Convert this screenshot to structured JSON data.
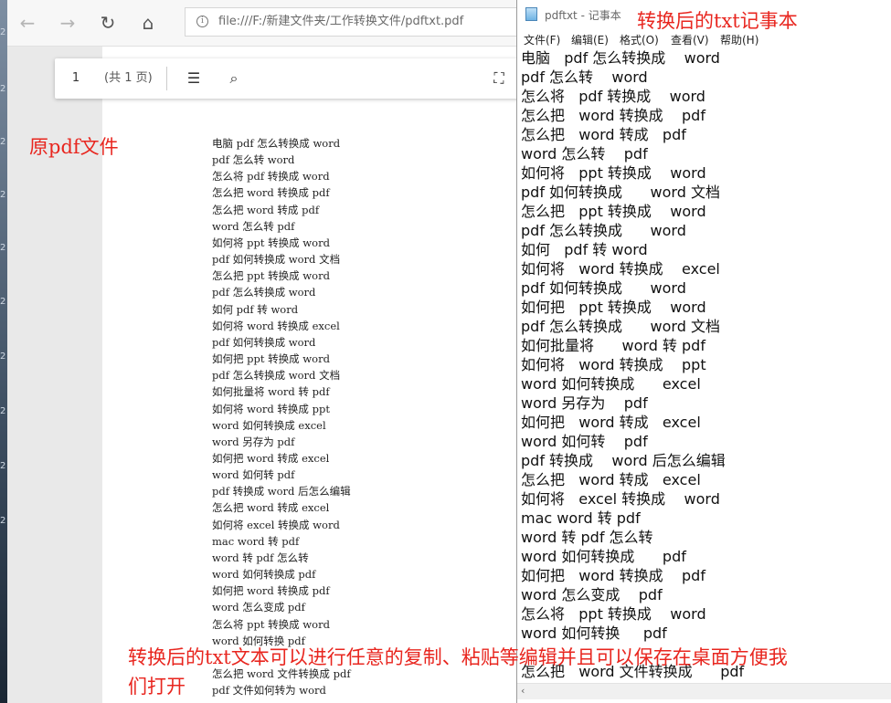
{
  "browser": {
    "back_icon": "←",
    "forward_icon": "→",
    "refresh_icon": "↻",
    "home_icon": "⌂",
    "info_icon": "i",
    "url": "file:///F:/新建文件夹/工作转换文件/pdftxt.pdf"
  },
  "pdf_toolbar": {
    "page_number": "1",
    "page_count": "(共 1 页)",
    "toc_icon": "☰",
    "search_icon": "⌕",
    "fit_icon": "⛶"
  },
  "pdf_lines": [
    "电脑 pdf 怎么转换成 word",
    "pdf 怎么转 word",
    "怎么将 pdf 转换成 word",
    "怎么把 word 转换成 pdf",
    "怎么把 word 转成 pdf",
    "word 怎么转 pdf",
    "如何将 ppt 转换成 word",
    "pdf 如何转换成 word 文档",
    "怎么把 ppt 转换成 word",
    "pdf 怎么转换成 word",
    "如何 pdf 转 word",
    "如何将 word 转换成 excel",
    "pdf 如何转换成 word",
    "如何把 ppt 转换成 word",
    "pdf 怎么转换成 word 文档",
    "如何批量将 word 转 pdf",
    "如何将 word 转换成 ppt",
    "word 如何转换成 excel",
    "word 另存为 pdf",
    "如何把 word 转成 excel",
    "word 如何转 pdf",
    "pdf 转换成 word 后怎么编辑",
    "怎么把 word 转成 excel",
    "如何将 excel 转换成 word",
    "mac word 转 pdf",
    "word 转 pdf 怎么转",
    "word 如何转换成 pdf",
    "如何把 word 转换成 pdf",
    "word 怎么变成 pdf",
    "怎么将 ppt 转换成 word",
    "word 如何转换 pdf",
    "",
    "怎么把 word 文件转换成 pdf",
    "pdf 文件如何转为 word"
  ],
  "annotations": {
    "pdf_label": "原pdf文件",
    "txt_label": "转换后的txt记事本",
    "bottom_line1": "转换后的txt文本可以进行任意的复制、粘贴等编辑并且可以保存在桌面方便我",
    "bottom_line2": "们打开"
  },
  "notepad": {
    "title": "pdftxt - 记事本",
    "menu": [
      "文件(F)",
      "编辑(E)",
      "格式(O)",
      "查看(V)",
      "帮助(H)"
    ],
    "scroll_left_icon": "‹",
    "lines": [
      "电脑   pdf 怎么转换成    word",
      "pdf 怎么转    word",
      "怎么将   pdf 转换成    word",
      "怎么把   word 转换成    pdf",
      "怎么把   word 转成   pdf",
      "word 怎么转    pdf",
      "如何将   ppt 转换成    word",
      "pdf 如何转换成      word 文档",
      "怎么把   ppt 转换成    word",
      "pdf 怎么转换成      word",
      "如何   pdf 转 word",
      "如何将   word 转换成    excel",
      "pdf 如何转换成      word",
      "如何把   ppt 转换成    word",
      "pdf 怎么转换成      word 文档",
      "如何批量将      word 转 pdf",
      "如何将   word 转换成    ppt",
      "word 如何转换成      excel",
      "word 另存为    pdf",
      "如何把   word 转成   excel",
      "word 如何转    pdf",
      "pdf 转换成    word 后怎么编辑",
      "怎么把   word 转成   excel",
      "如何将   excel 转换成    word",
      "mac word 转 pdf",
      "word 转 pdf 怎么转",
      "word 如何转换成      pdf",
      "如何把   word 转换成    pdf",
      "word 怎么变成    pdf",
      "怎么将   ppt 转换成    word",
      "word 如何转换     pdf",
      "",
      "怎么把   word 文件转换成      pdf"
    ]
  }
}
